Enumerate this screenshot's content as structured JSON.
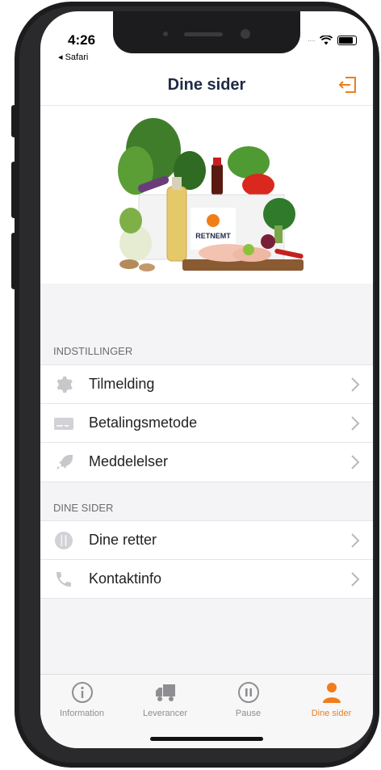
{
  "status_bar": {
    "time": "4:26",
    "back_app": "◂ Safari"
  },
  "header": {
    "title": "Dine sider",
    "logout_icon": "logout-icon"
  },
  "hero": {
    "brand": "RETNEMT"
  },
  "sections": [
    {
      "title": "INDSTILLINGER",
      "items": [
        {
          "label": "Tilmelding",
          "icon": "gear-icon"
        },
        {
          "label": "Betalingsmetode",
          "icon": "credit-card-icon"
        },
        {
          "label": "Meddelelser",
          "icon": "rocket-icon"
        }
      ]
    },
    {
      "title": "DINE SIDER",
      "items": [
        {
          "label": "Dine retter",
          "icon": "cutlery-icon"
        },
        {
          "label": "Kontaktinfo",
          "icon": "phone-icon"
        }
      ]
    }
  ],
  "tabbar": {
    "tabs": [
      {
        "label": "Information",
        "icon": "info-icon",
        "active": false
      },
      {
        "label": "Leverancer",
        "icon": "truck-icon",
        "active": false
      },
      {
        "label": "Pause",
        "icon": "pause-icon",
        "active": false
      },
      {
        "label": "Dine sider",
        "icon": "person-icon",
        "active": true
      }
    ]
  },
  "colors": {
    "accent": "#f07d1a",
    "title": "#1f2a44",
    "icon_gray": "#c7c7cc"
  }
}
